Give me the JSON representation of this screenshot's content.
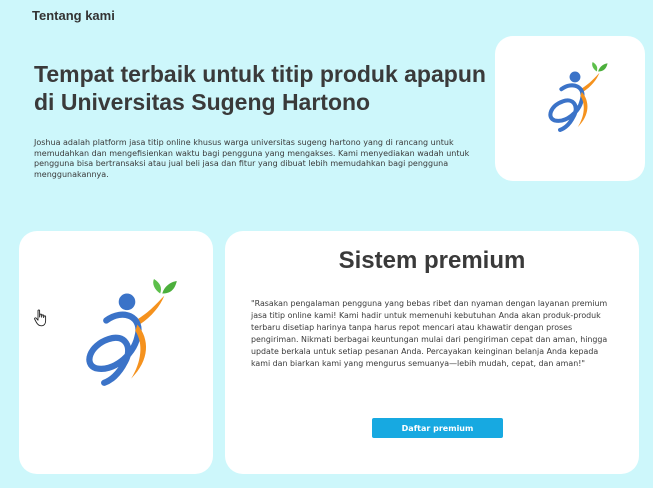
{
  "nav": {
    "title": "Tentang kami"
  },
  "hero": {
    "title": "Tempat terbaik untuk titip produk apapun di Universitas Sugeng Hartono",
    "description": "Joshua adalah platform jasa titip online khusus warga universitas sugeng hartono yang di rancang untuk memudahkan dan mengefisienkan waktu bagi pengguna yang mengakses. Kami menyediakan wadah untuk pengguna bisa bertransaksi atau jual beli jasa dan fitur yang dibuat lebih memudahkan bagi pengguna menggunakannya."
  },
  "premium": {
    "title": "Sistem premium",
    "text": "\"Rasakan pengalaman pengguna yang bebas ribet dan nyaman dengan layanan premium jasa titip online kami! Kami hadir untuk memenuhi kebutuhan Anda akan produk-produk terbaru disetiap harinya tanpa harus repot mencari atau khawatir dengan proses pengiriman. Nikmati berbagai keuntungan mulai dari pengiriman cepat dan aman, hingga update berkala untuk setiap pesanan Anda. Percayakan keinginan belanja Anda kepada kami dan biarkan kami yang mengurus semuanya—lebih mudah, cepat, dan aman!\"",
    "button_label": "Daftar premium"
  },
  "logo": {
    "icon": "person-leaf-logo",
    "colors": {
      "blue": "#3b73c8",
      "orange": "#f5921e",
      "green": "#4caf3c"
    }
  },
  "theme": {
    "background": "#cdf7fb",
    "card": "#ffffff",
    "button": "#17a9e1",
    "text": "#3a3a3a"
  },
  "cursor": {
    "icon": "hand-pointer-icon"
  }
}
